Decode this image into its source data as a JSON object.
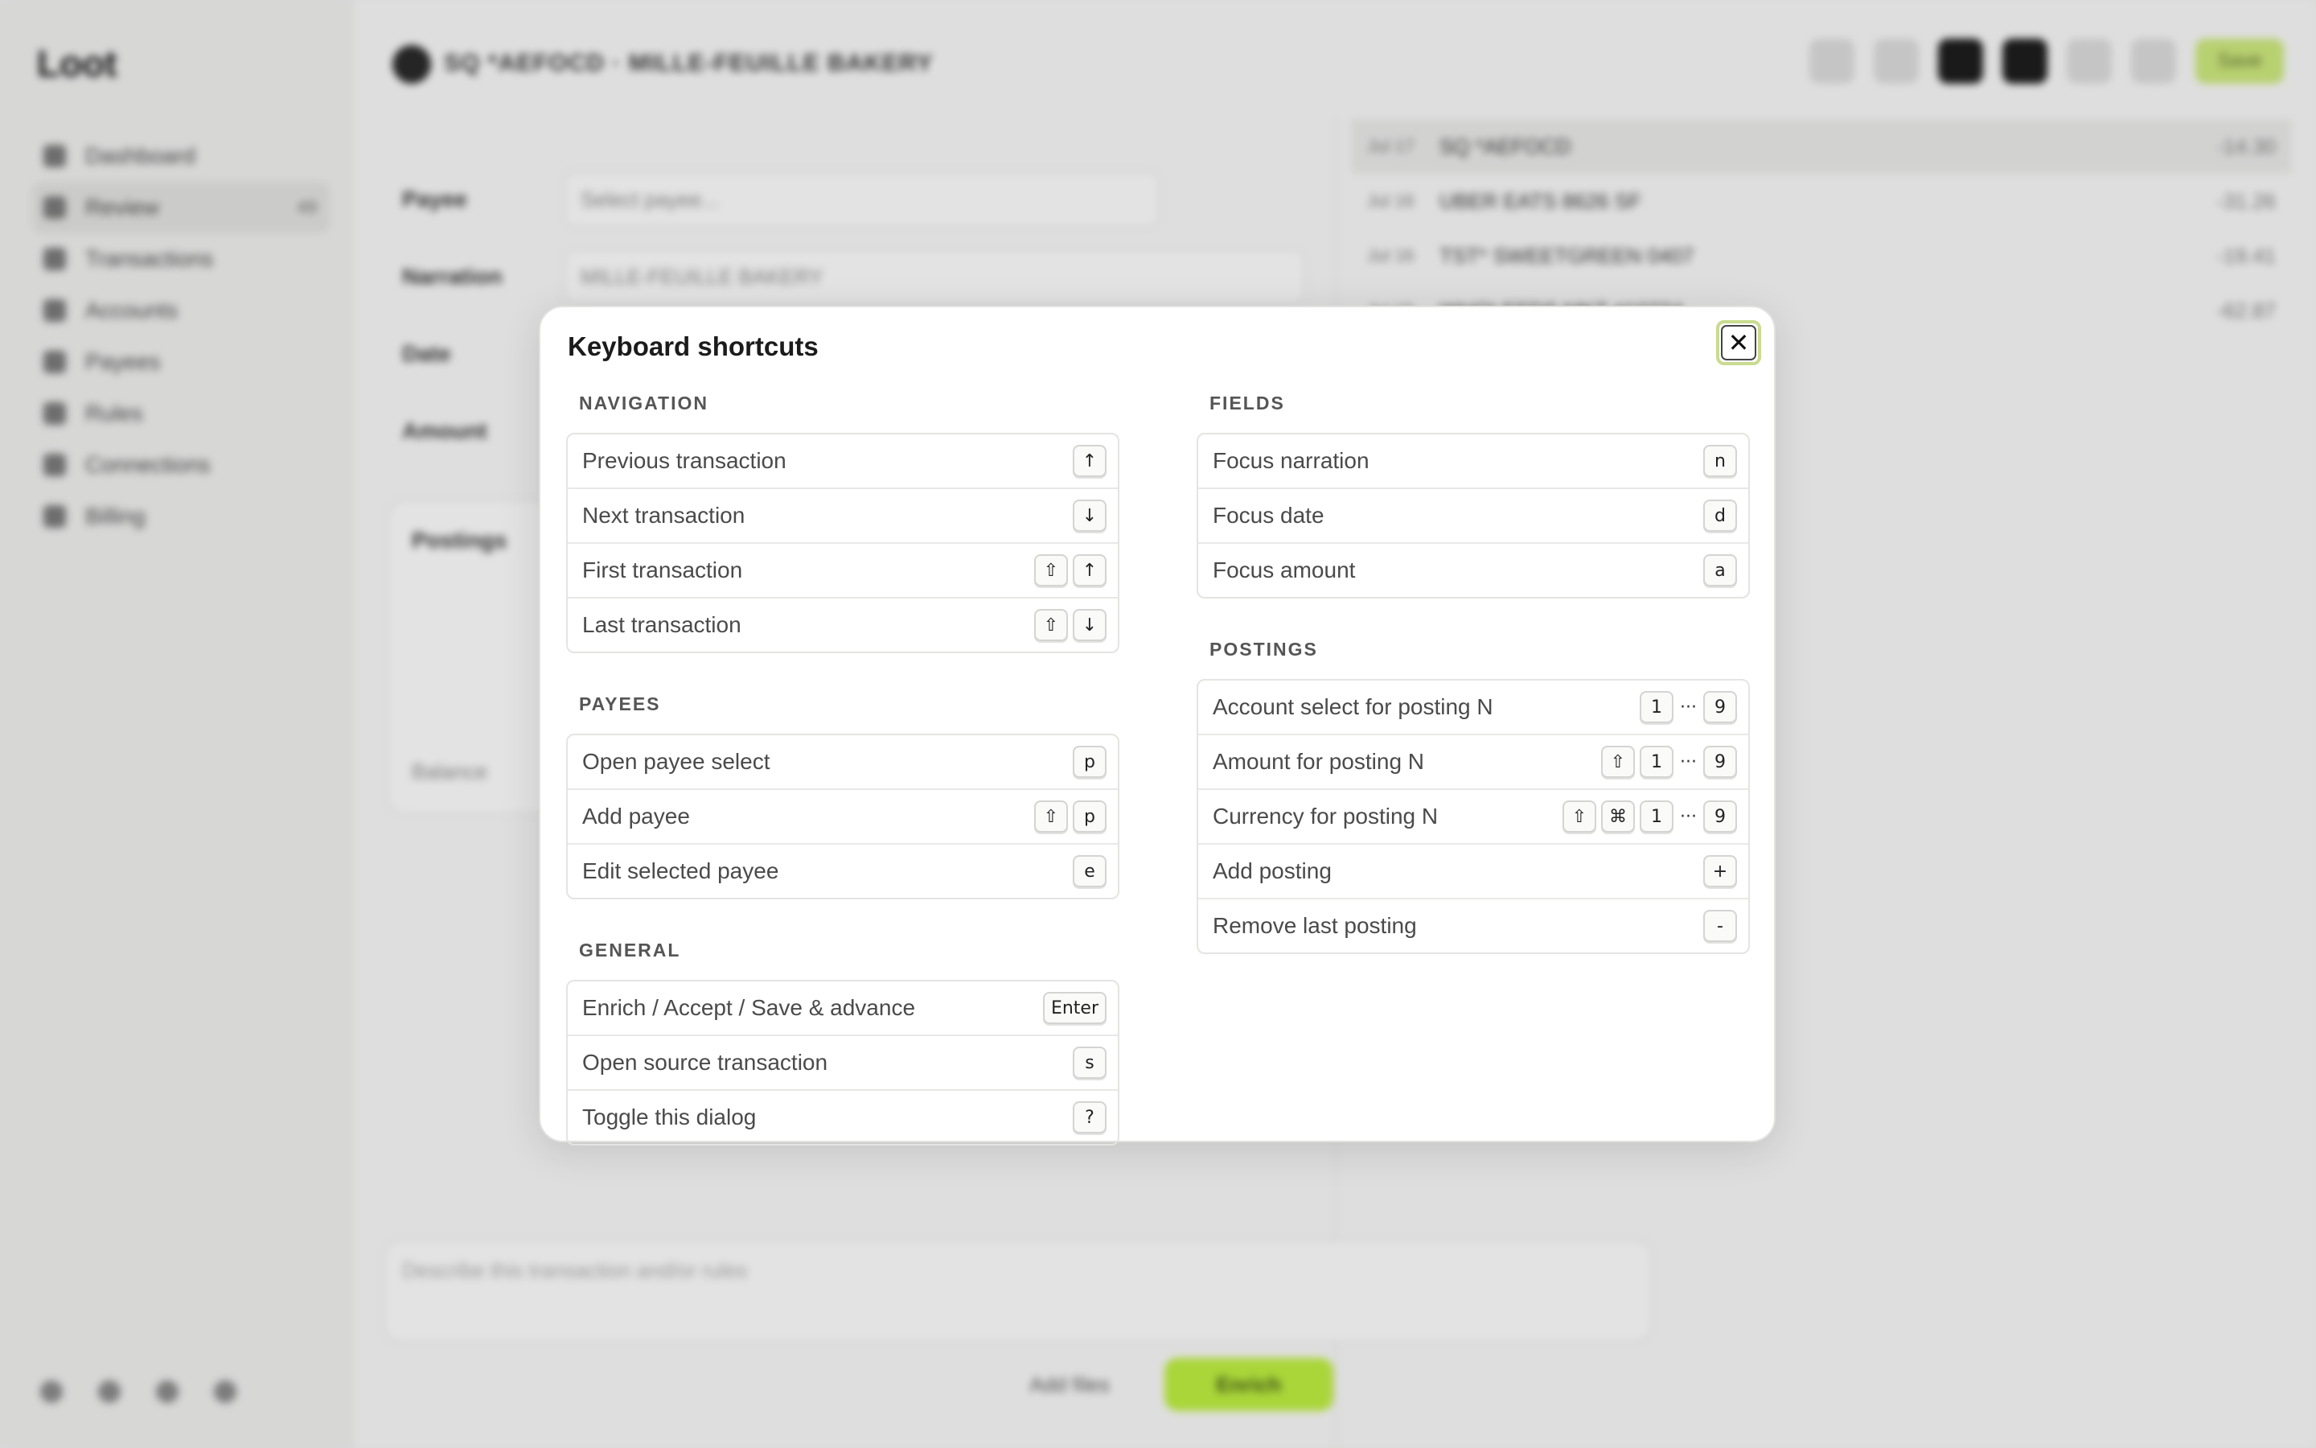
{
  "app": {
    "logo": "Loot",
    "nav": [
      "Dashboard",
      "Review",
      "Transactions",
      "Accounts",
      "Payees",
      "Rules",
      "Connections",
      "Billing"
    ],
    "review_badge": "49"
  },
  "header": {
    "title": "SQ *AEFOCD · MILLE-FEUILLE BAKERY",
    "save_label": "Save"
  },
  "form": {
    "payee_label": "Payee",
    "payee_placeholder": "Select payee...",
    "narration_label": "Narration",
    "narration_value": "MILLE-FEUILLE BAKERY",
    "date_label": "Date",
    "amount_label": "Amount",
    "postings_label": "Postings",
    "balance_label": "Balance"
  },
  "transactions": [
    {
      "date": "Jul 17",
      "desc": "SQ *AEFOCD",
      "amount": "-14.30"
    },
    {
      "date": "Jul 16",
      "desc": "UBER EATS 8626 SF",
      "amount": "-31.26"
    },
    {
      "date": "Jul 16",
      "desc": "TST* SWEETGREEN 0407",
      "amount": "-19.41"
    },
    {
      "date": "Jul 15",
      "desc": "WHOLEFDS MKT #10234",
      "amount": "-62.87"
    }
  ],
  "compose": {
    "placeholder": "Describe this transaction and/or rules",
    "add_files": "Add files",
    "enrich": "Enrich"
  },
  "modal": {
    "title": "Keyboard shortcuts",
    "close_icon": "close-icon",
    "sections": {
      "navigation": {
        "title": "NAVIGATION",
        "rows": [
          {
            "label": "Previous transaction",
            "keys": [
              "↑"
            ]
          },
          {
            "label": "Next transaction",
            "keys": [
              "↓"
            ]
          },
          {
            "label": "First transaction",
            "keys": [
              "⇧",
              "↑"
            ]
          },
          {
            "label": "Last transaction",
            "keys": [
              "⇧",
              "↓"
            ]
          }
        ]
      },
      "payees": {
        "title": "PAYEES",
        "rows": [
          {
            "label": "Open payee select",
            "keys": [
              "p"
            ]
          },
          {
            "label": "Add payee",
            "keys": [
              "⇧",
              "p"
            ]
          },
          {
            "label": "Edit selected payee",
            "keys": [
              "e"
            ]
          }
        ]
      },
      "general": {
        "title": "GENERAL",
        "rows": [
          {
            "label": "Enrich / Accept / Save & advance",
            "keys": [
              "Enter"
            ]
          },
          {
            "label": "Open source transaction",
            "keys": [
              "s"
            ]
          },
          {
            "label": "Toggle this dialog",
            "keys": [
              "?"
            ]
          }
        ]
      },
      "fields": {
        "title": "FIELDS",
        "rows": [
          {
            "label": "Focus narration",
            "keys": [
              "n"
            ]
          },
          {
            "label": "Focus date",
            "keys": [
              "d"
            ]
          },
          {
            "label": "Focus amount",
            "keys": [
              "a"
            ]
          }
        ]
      },
      "postings": {
        "title": "POSTINGS",
        "rows": [
          {
            "label": "Account select for posting N",
            "keys": [
              "1",
              "···",
              "9"
            ]
          },
          {
            "label": "Amount for posting N",
            "keys": [
              "⇧",
              "1",
              "···",
              "9"
            ]
          },
          {
            "label": "Currency for posting N",
            "keys": [
              "⇧",
              "⌘",
              "1",
              "···",
              "9"
            ]
          },
          {
            "label": "Add posting",
            "keys": [
              "+"
            ]
          },
          {
            "label": "Remove last posting",
            "keys": [
              "-"
            ]
          }
        ]
      }
    }
  }
}
